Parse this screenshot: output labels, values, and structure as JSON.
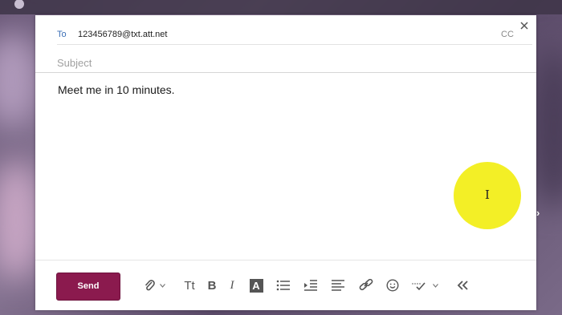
{
  "compose": {
    "to_label": "To",
    "to_value": "123456789@txt.att.net",
    "cc_label": "CC",
    "subject_placeholder": "Subject",
    "body_text": "Meet me in 10 minutes."
  },
  "toolbar": {
    "send_label": "Send",
    "font_size_label": "Tt",
    "bold_label": "B",
    "italic_label": "I",
    "text_color_label": "A",
    "icons": [
      "paperclip-icon",
      "chevron-down-icon",
      "bullet-list-icon",
      "indent-icon",
      "align-icon",
      "link-icon",
      "emoji-icon",
      "spellcheck-icon",
      "collapse-icon"
    ]
  },
  "colors": {
    "send_button": "#8b1a4e",
    "to_label": "#3b6fb6",
    "cursor_highlight": "#f2ee1a"
  }
}
